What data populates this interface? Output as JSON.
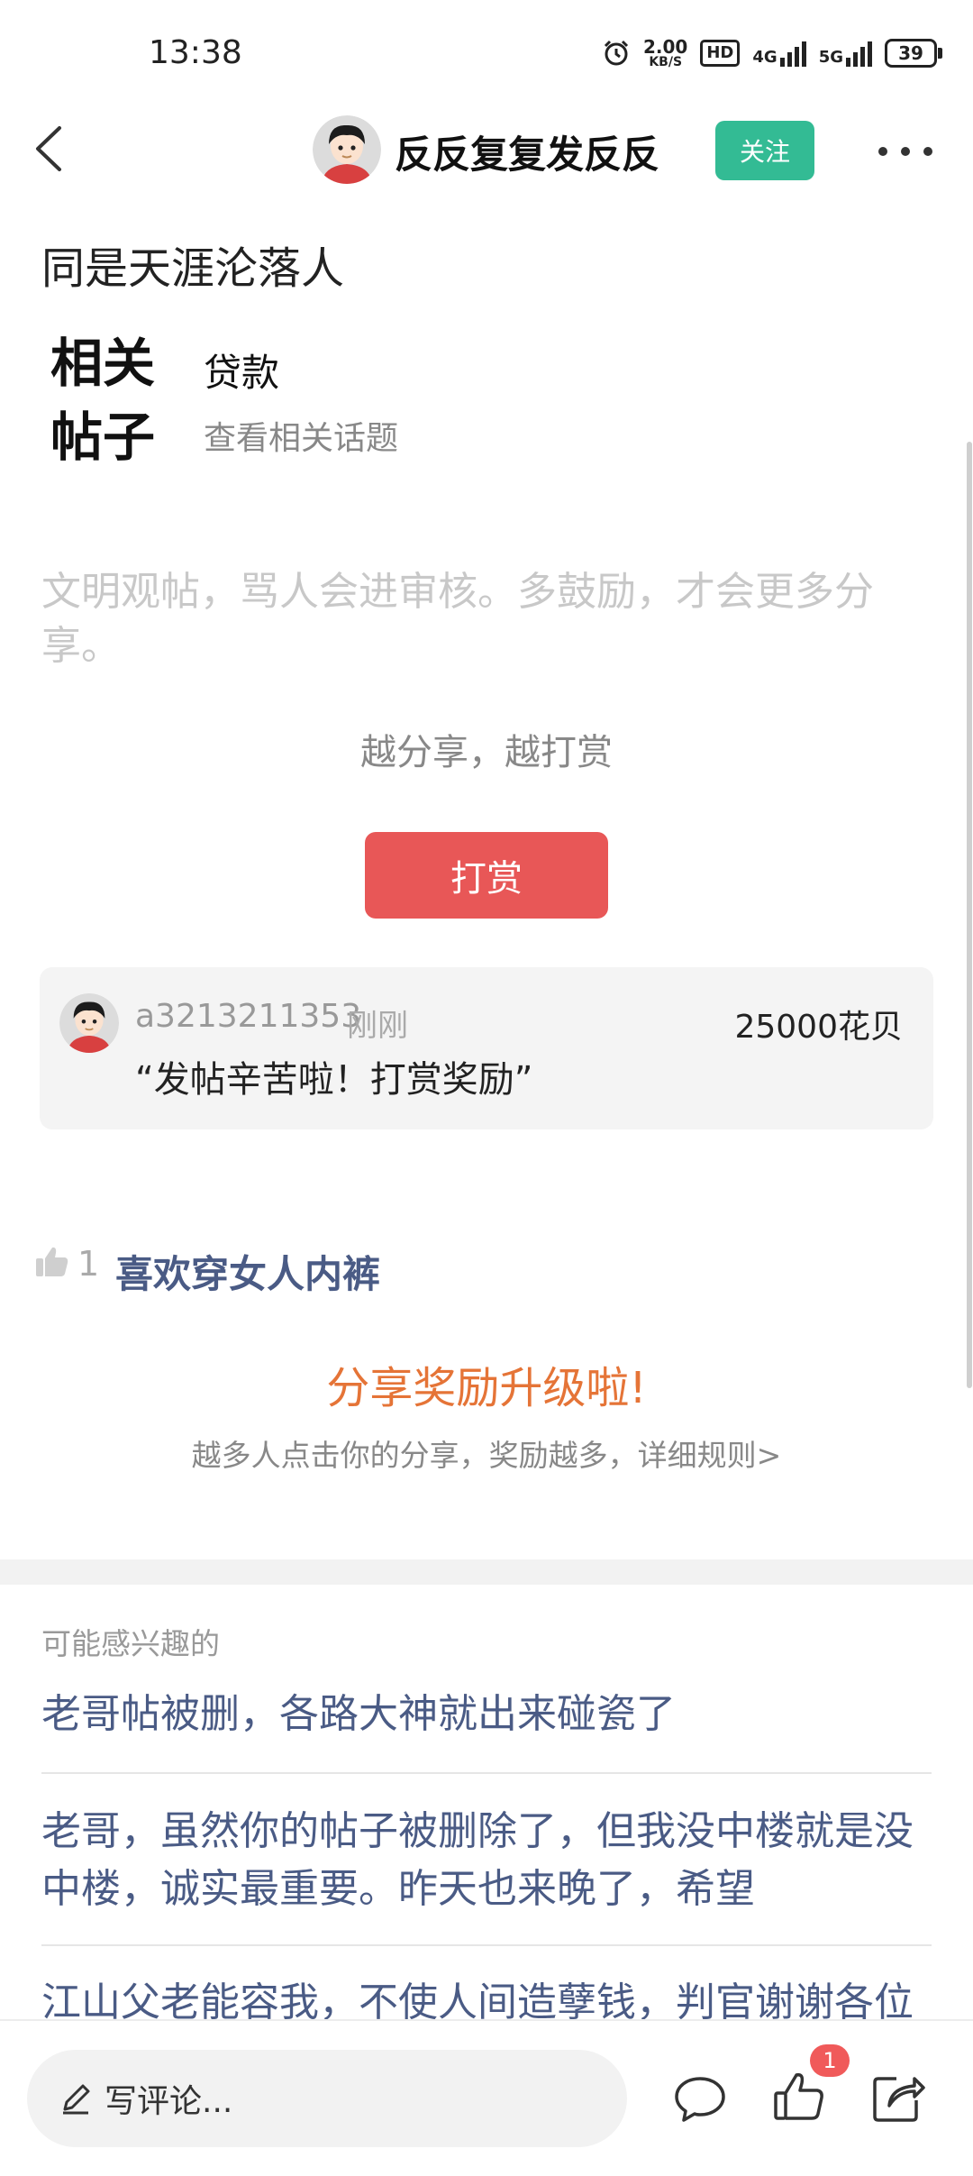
{
  "status_bar": {
    "time": "13:38",
    "speed_value": "2.00",
    "speed_unit": "KB/S",
    "hd": "HD",
    "network_1": "4G",
    "network_2": "5G",
    "battery": "39",
    "icons": [
      "alarm-icon",
      "signal-icon",
      "battery-icon"
    ]
  },
  "header": {
    "author_name": "反反复复发反反",
    "follow_label": "关注",
    "icons": [
      "back-icon",
      "more-icon"
    ]
  },
  "post": {
    "title": "同是天涯沦落人",
    "related_label": "相关帖子",
    "related_topic": "贷款",
    "related_link": "查看相关话题",
    "notice": "文明观帖，骂人会进审核。多鼓励，才会更多分享。"
  },
  "reward": {
    "slogan": "越分享，越打赏",
    "button_label": "打赏",
    "user": "a3213211353",
    "time": "刚刚",
    "amount": "25000花贝",
    "message": "“发帖辛苦啦！打赏奖励”"
  },
  "likes": {
    "count": "1",
    "user": "喜欢穿女人内裤"
  },
  "share_promo": {
    "title": "分享奖励升级啦!",
    "description": "越多人点击你的分享，奖励越多，详细规则>"
  },
  "recommendations": {
    "label": "可能感兴趣的",
    "items": [
      "老哥帖被删，各路大神就出来碰瓷了",
      "老哥，虽然你的帖子被删除了，但我没中楼就是没中楼，诚实最重要。昨天也来晚了，希望",
      "江山父老能容我，不使人间造孽钱，判官谢谢各位"
    ]
  },
  "bottom_bar": {
    "comment_placeholder": "写评论...",
    "like_badge": "1",
    "icons": [
      "pencil-icon",
      "comment-icon",
      "thumb-up-icon",
      "share-icon"
    ]
  },
  "colors": {
    "follow": "#33bb94",
    "reward_button": "#e85757",
    "link": "#4a5b85",
    "promo": "#e57437",
    "badge": "#f05a5a"
  }
}
